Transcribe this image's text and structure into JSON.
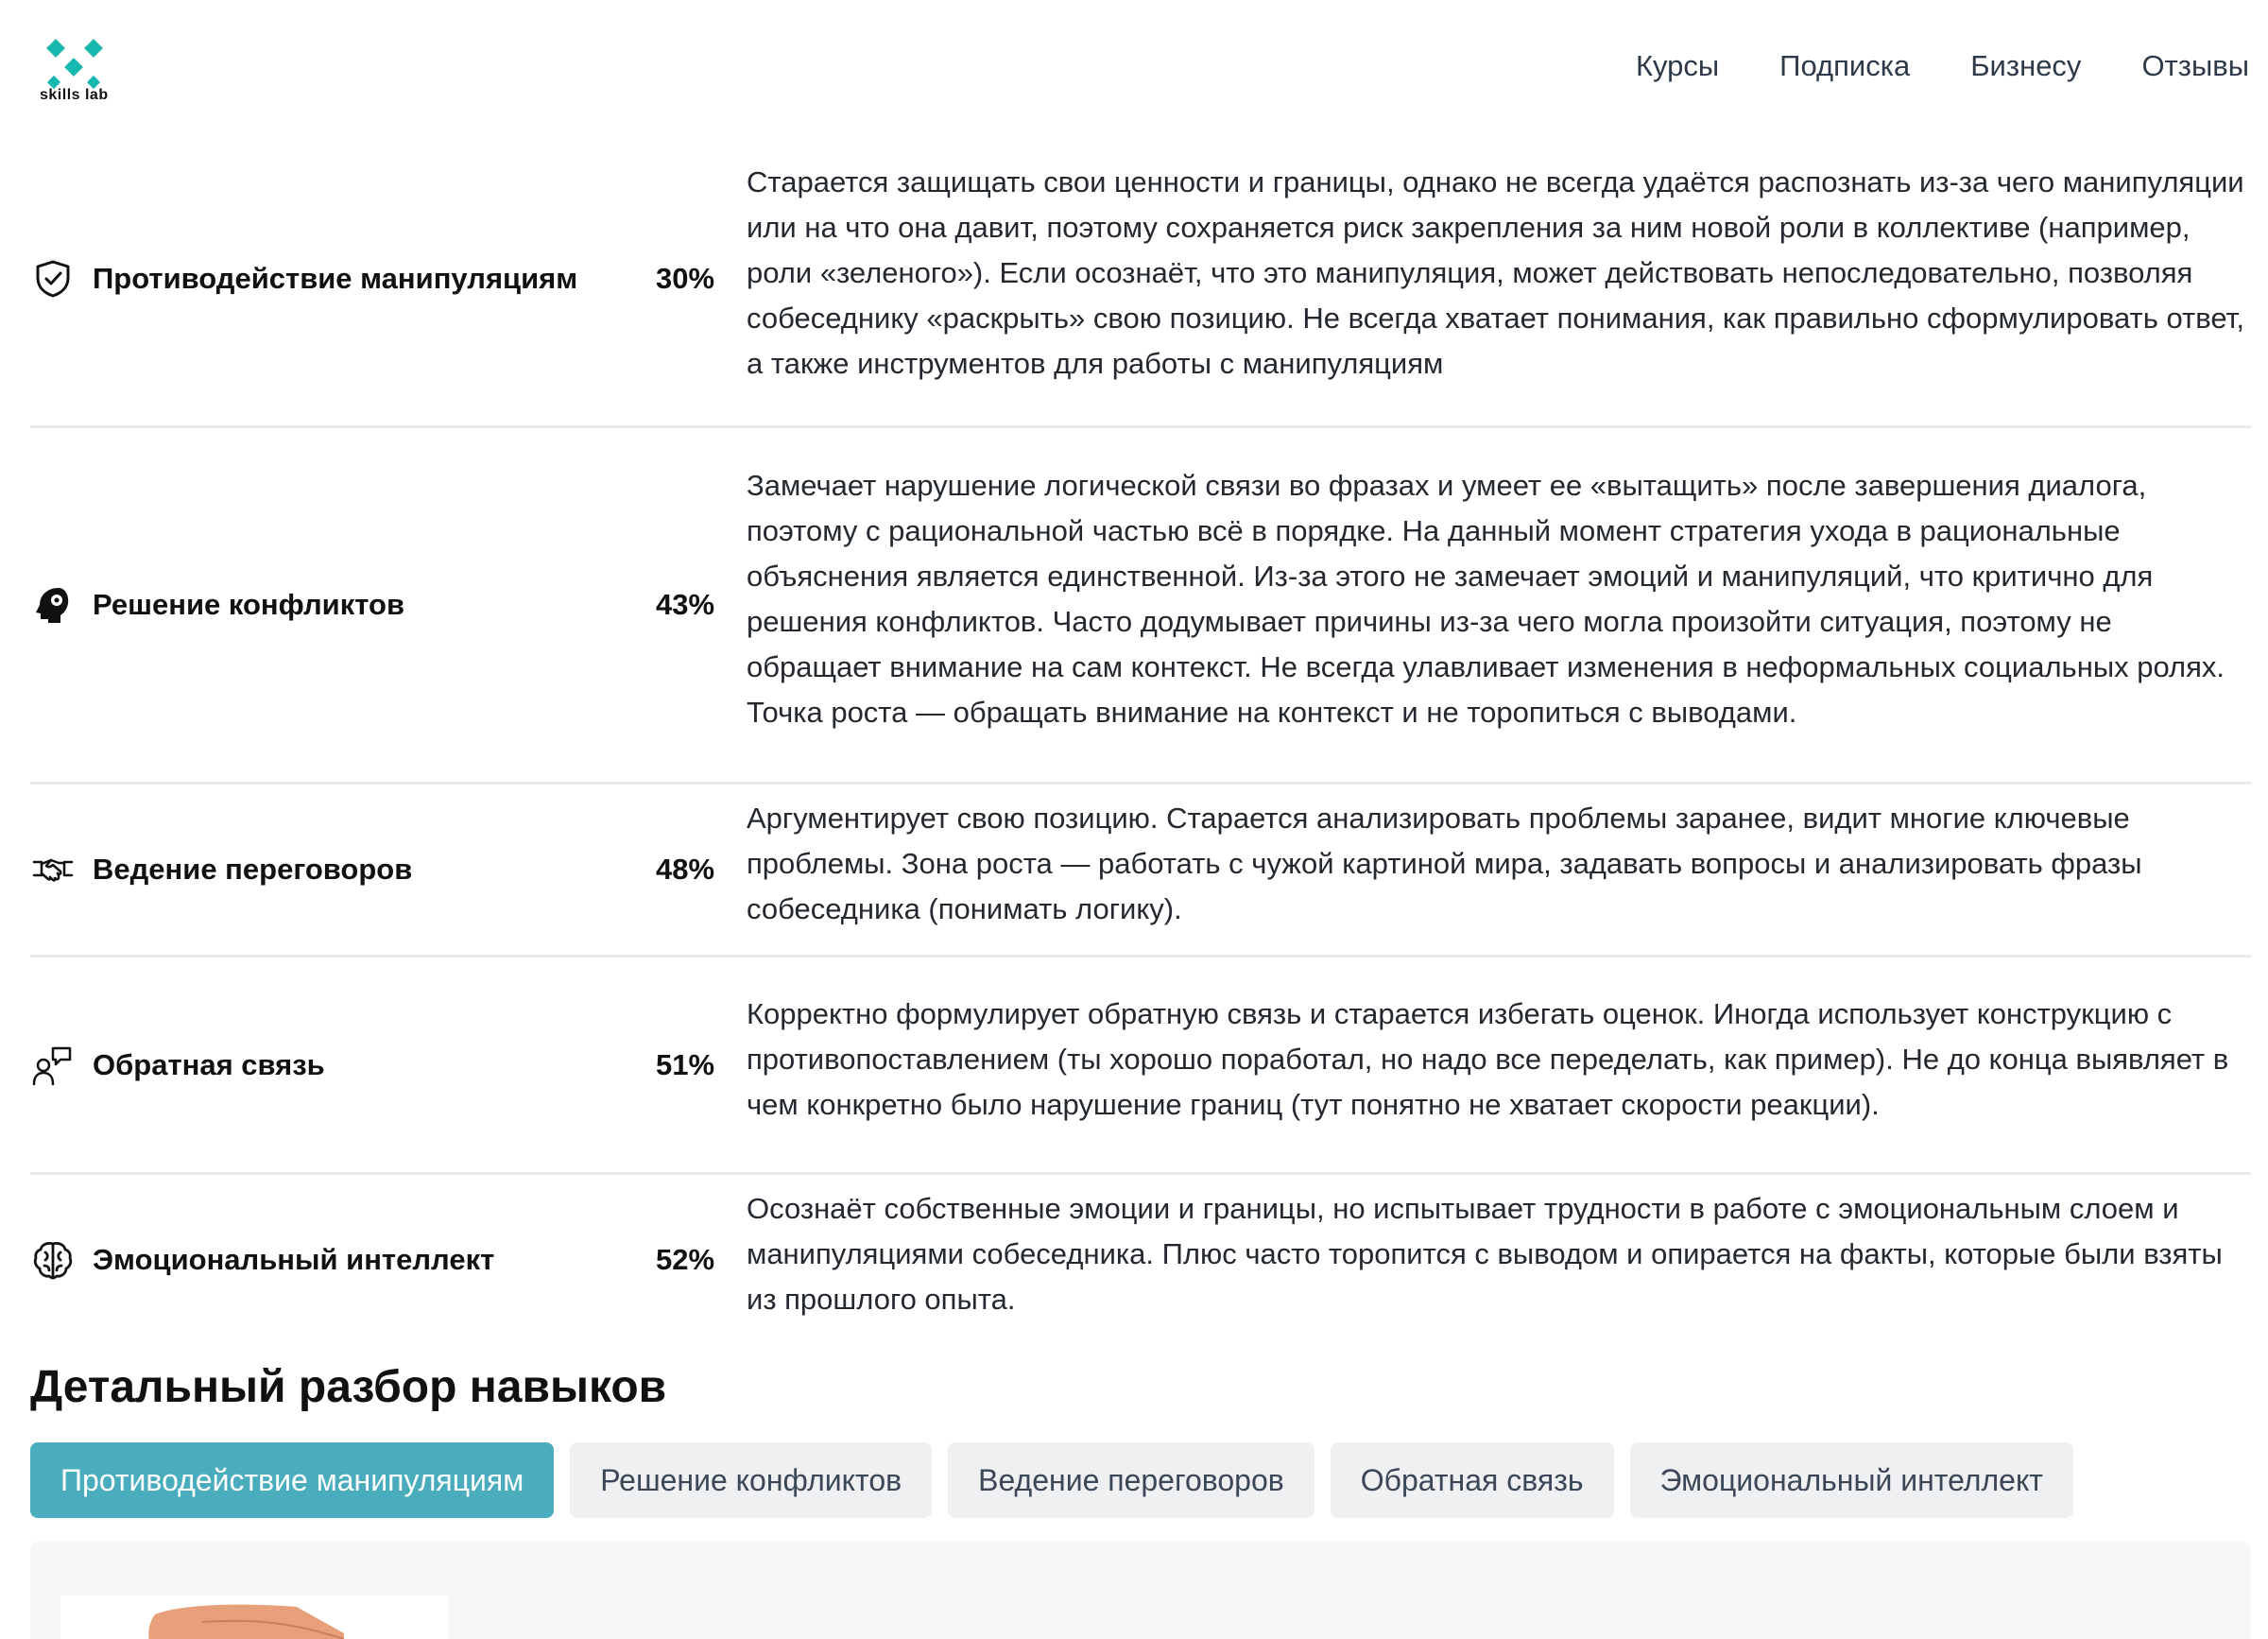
{
  "brand": {
    "logo_text": "skills  lab",
    "accent_color": "#17b8b0"
  },
  "nav": {
    "items": [
      "Курсы",
      "Подписка",
      "Бизнесу",
      "Отзывы"
    ]
  },
  "skills": [
    {
      "icon": "shield-check-icon",
      "name": "Противодействие манипуляциям",
      "percent": "30%",
      "description": "Старается защищать свои ценности и границы, однако не всегда удаётся распознать из-за чего манипуляции или на что она давит, поэтому сохраняется риск закрепления за ним новой роли в коллективе (например, роли «зеленого»). Если осознаёт, что это манипуляция, может действовать непоследовательно, позволяя собеседнику «раскрыть» свою позицию. Не всегда хватает понимания, как правильно сформулировать ответ, а также инструментов для работы с манипуляциям"
    },
    {
      "icon": "head-gear-icon",
      "name": "Решение конфликтов",
      "percent": "43%",
      "description": "Замечает нарушение логической связи во фразах и умеет ее «вытащить» после завершения диалога, поэтому с рациональной частью всё в порядке. На данный момент стратегия ухода в рациональные объяснения является единственной. Из-за этого не замечает эмоций и манипуляций, что критично для решения конфликтов. Часто додумывает причины из-за чего могла произойти ситуация, поэтому не обращает внимание на сам контекст. Не всегда улавливает изменения в неформальных социальных ролях. Точка роста — обращать внимание на контекст и не торопиться с выводами."
    },
    {
      "icon": "handshake-icon",
      "name": "Ведение переговоров",
      "percent": "48%",
      "description": "Аргументирует свою позицию. Старается анализировать проблемы заранее, видит многие ключевые проблемы. Зона роста — работать с чужой картиной мира, задавать вопросы и анализировать фразы собеседника (понимать логику)."
    },
    {
      "icon": "person-speech-icon",
      "name": "Обратная связь",
      "percent": "51%",
      "description": "Корректно формулирует обратную связь и старается избегать оценок. Иногда использует конструкцию с противопоставлением (ты хорошо поработал, но надо все переделать, как пример). Не до конца выявляет в чем конкретно было нарушение границ (тут понятно не хватает скорости реакции)."
    },
    {
      "icon": "brain-icon",
      "name": "Эмоциональный интеллект",
      "percent": "52%",
      "description": "Осознаёт собственные эмоции и границы, но испытывает трудности в работе с эмоциональным слоем и манипуляциями собеседника. Плюс часто торопится с выводом и опирается на факты, которые были взяты из прошлого опыта."
    }
  ],
  "details": {
    "title": "Детальный разбор навыков",
    "tabs": [
      "Противодействие манипуляциям",
      "Решение конфликтов",
      "Ведение переговоров",
      "Обратная связь",
      "Эмоциональный интеллект"
    ],
    "active_tab": 0,
    "active_color": "#4aadbd"
  }
}
